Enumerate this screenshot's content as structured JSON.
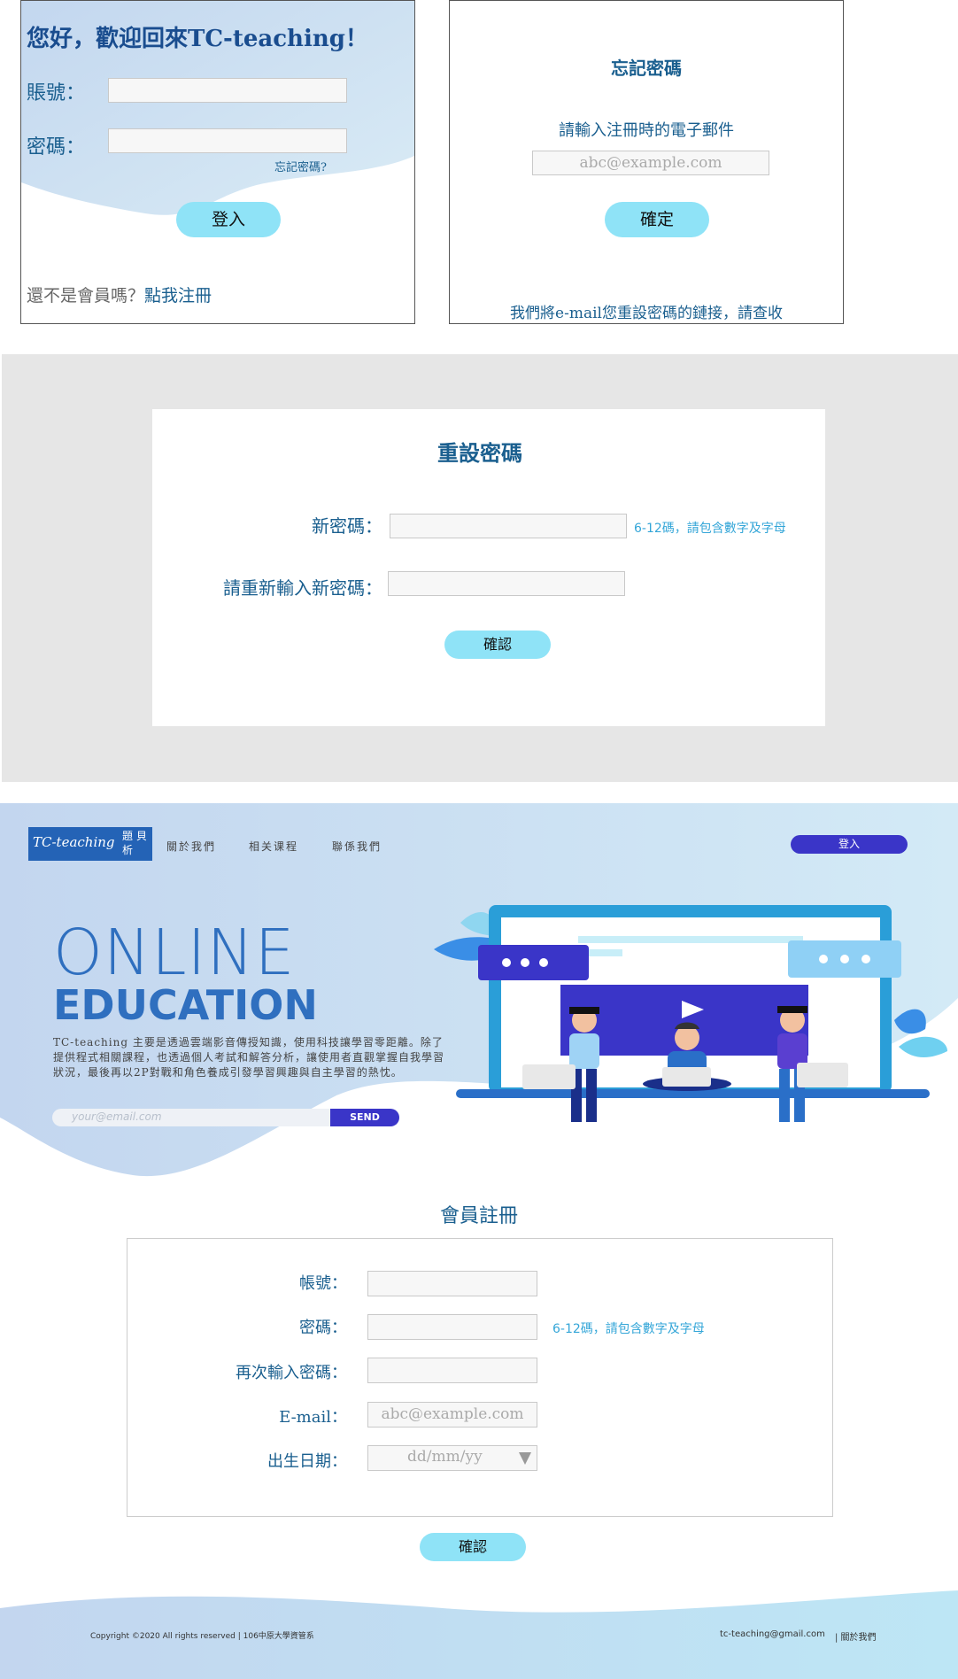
{
  "login": {
    "greeting": "您好，歡迎回來TC-teaching！",
    "account_label": "賬號：",
    "password_label": "密碼：",
    "forgot_link": "忘記密碼?",
    "login_button": "登入",
    "register_prompt": "還不是會員嗎？",
    "register_link": "點我注冊"
  },
  "forgot": {
    "title": "忘記密碼",
    "instruction": "請輸入注冊時的電子郵件",
    "email_placeholder": "abc@example.com",
    "confirm_button": "確定",
    "notice": "我們將e-mail您重設密碼的鏈接，請查收"
  },
  "reset": {
    "title": "重設密碼",
    "new_password_label": "新密碼：",
    "password_hint": "6-12碼，請包含數字及字母",
    "repeat_label": "請重新輸入新密碼：",
    "confirm_button": "確認"
  },
  "home": {
    "logo_main": "TC-teaching",
    "logo_side": "題 貝 析",
    "nav": [
      "關於我們",
      "相关课程",
      "聯係我們"
    ],
    "login_button": "登入",
    "hero_line1": "ONLINE",
    "hero_line2": "EDUCATION",
    "description": "TC-teaching 主要是透過雲端影音傳授知識，使用科技讓學習零距離。除了提供程式相關課程，也透過個人考試和解答分析，讓使用者直觀掌握自我學習狀況，最後再以2P對戰和角色養成引發學習興趣與自主學習的熱忱。",
    "subscribe_placeholder": "your@email.com",
    "send_button": "SEND"
  },
  "register": {
    "title": "會員註冊",
    "account_label": "帳號：",
    "password_label": "密碼：",
    "password_hint": "6-12碼，請包含數字及字母",
    "repeat_label": "再次輸入密碼：",
    "email_label": "E-mail：",
    "email_placeholder": "abc@example.com",
    "birthday_label": "出生日期：",
    "birthday_placeholder": "dd/mm/yy",
    "confirm_button": "確認"
  },
  "footer": {
    "copyright": "Copyright ©2020 All rights reserved | 106中原大學資管系",
    "email": "tc-teaching@gmail.com",
    "about": "| 關於我們"
  },
  "colors": {
    "primary_text": "#1a5f8f",
    "button": "#8fe3f7",
    "accent_blue": "#3a35c8",
    "hint": "#34a6d8",
    "section_bg": "#e6e6e6"
  }
}
